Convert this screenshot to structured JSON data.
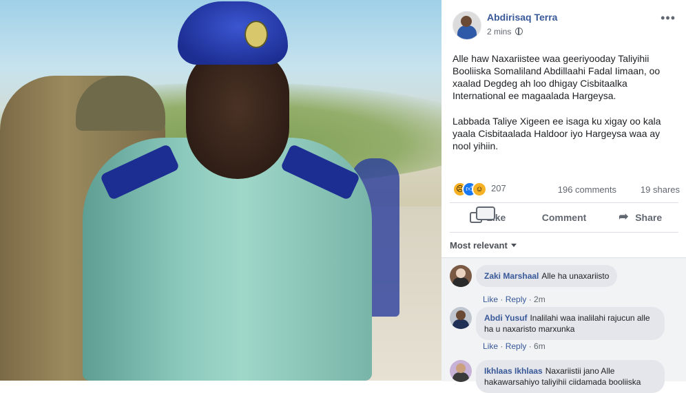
{
  "post": {
    "author": "Abdirisaq Terra",
    "time": "2 mins",
    "paragraph1": "Alle haw Naxariistee waa geeriyooday Taliyihii Booliiska Somaliland Abdillaahi Fadal Iimaan, oo xaalad Degdeg ah loo dhigay Cisbitaalka International ee magaalada Hargeysa.",
    "paragraph2": "Labbada Taliye Xigeen ee isaga ku xigay oo kala yaala Cisbitaalada Haldoor iyo Hargeysa waa ay nool yihiin.",
    "reaction_count": "207",
    "comments_count": "196 comments",
    "shares_count": "19 shares"
  },
  "actions": {
    "like": "Like",
    "comment": "Comment",
    "share": "Share"
  },
  "sort_label": "Most relevant",
  "comments": [
    {
      "name": "Zaki Marshaal",
      "text": "Alle ha unaxariisto",
      "like": "Like",
      "reply": "Reply",
      "time": "2m"
    },
    {
      "name": "Abdi Yusuf",
      "text": "Inalilahi waa inalilahi rajucun alle ha u naxaristo marxunka",
      "like": "Like",
      "reply": "Reply",
      "time": "6m"
    },
    {
      "name": "Ikhlaas Ikhlaas",
      "text": "Naxariistii jano Alle hakawarsahiyo taliyihii ciidamada booliiska"
    }
  ],
  "icons": [
    "globe-icon",
    "more-options-icon",
    "sad-reaction-icon",
    "like-reaction-icon",
    "haha-reaction-icon",
    "like-icon",
    "comment-icon",
    "share-icon",
    "chevron-down-icon"
  ]
}
